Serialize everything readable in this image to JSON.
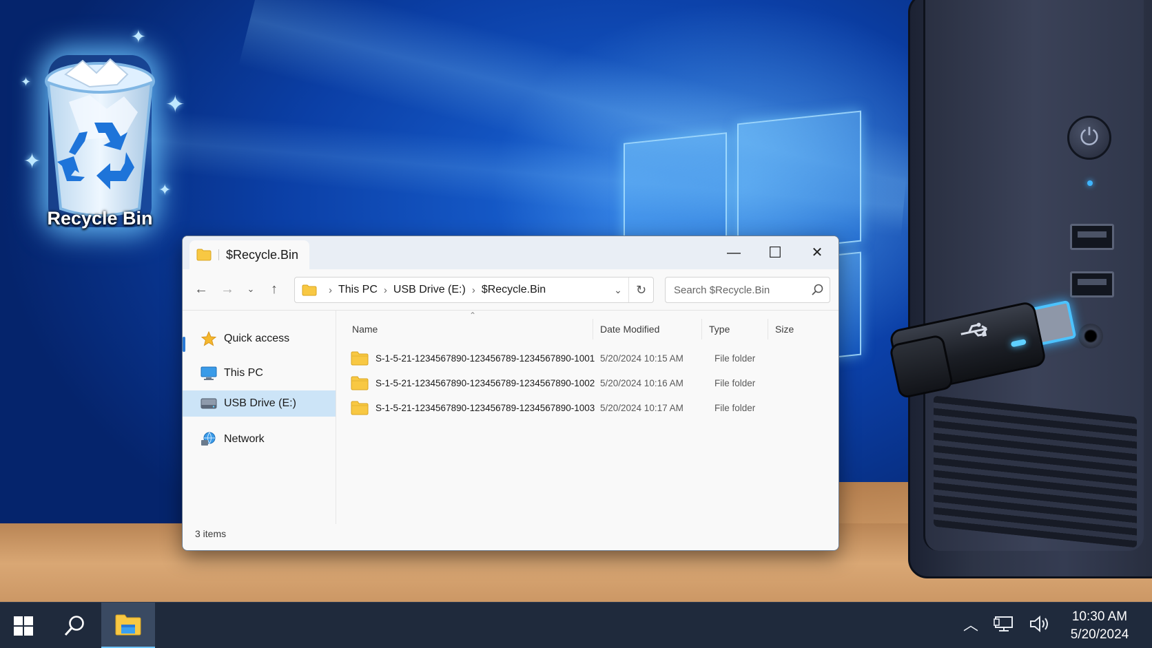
{
  "desktop": {
    "recycle_bin_label": "Recycle Bin"
  },
  "window": {
    "tab_title": "$Recycle.Bin",
    "controls": {
      "minimize": "—",
      "maximize": "☐",
      "close": "✕"
    }
  },
  "toolbar": {
    "breadcrumbs": [
      "This PC",
      "USB Drive (E:)",
      "$Recycle.Bin"
    ],
    "search_placeholder": "Search $Recycle.Bin"
  },
  "nav_pane": {
    "items": [
      {
        "label": "Quick access",
        "icon": "star-icon"
      },
      {
        "label": "This PC",
        "icon": "monitor-icon"
      },
      {
        "label": "USB Drive (E:)",
        "icon": "drive-icon",
        "selected": true
      },
      {
        "label": "Network",
        "icon": "network-icon"
      }
    ]
  },
  "file_list": {
    "columns": [
      "Name",
      "Date Modified",
      "Type",
      "Size"
    ],
    "rows": [
      {
        "name": "S-1-5-21-1234567890-123456789-1234567890-1001",
        "date": "5/20/2024 10:15 AM",
        "type": "File folder",
        "size": ""
      },
      {
        "name": "S-1-5-21-1234567890-123456789-1234567890-1002",
        "date": "5/20/2024 10:16 AM",
        "type": "File folder",
        "size": ""
      },
      {
        "name": "S-1-5-21-1234567890-123456789-1234567890-1003",
        "date": "5/20/2024 10:17 AM",
        "type": "File folder",
        "size": ""
      }
    ]
  },
  "status": {
    "item_count": "3 items"
  },
  "taskbar": {
    "time": "10:30 AM",
    "date": "5/20/2024"
  },
  "colors": {
    "accent": "#0078d4",
    "folder": "#f8c843",
    "selection": "#cce4f7",
    "taskbar": "#1f2a3c"
  }
}
